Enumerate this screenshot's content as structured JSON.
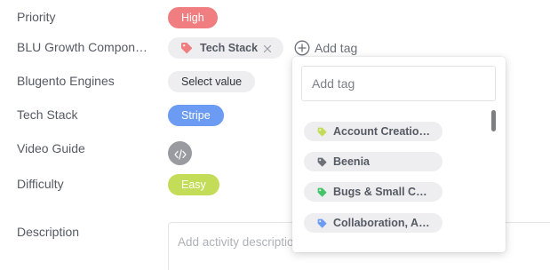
{
  "fields": {
    "priority": {
      "label": "Priority",
      "value": "High",
      "color": "#f07e80"
    },
    "blu_growth": {
      "label": "BLU Growth Compon…",
      "tag": {
        "label": "Tech Stack",
        "icon": "tag-icon",
        "color": "#f07e80"
      },
      "remove_icon": "close-icon",
      "add_tag_label": "Add tag",
      "add_tag_icon": "plus-circle-icon"
    },
    "blugento_engines": {
      "label": "Blugento Engines",
      "value": "Select value"
    },
    "tech_stack": {
      "label": "Tech Stack",
      "value": "Stripe",
      "color": "#6b9bf2"
    },
    "video_guide": {
      "label": "Video Guide",
      "icon": "code-icon"
    },
    "difficulty": {
      "label": "Difficulty",
      "value": "Easy",
      "color": "#c3dd58"
    },
    "description": {
      "label": "Description",
      "placeholder": "Add activity descriptio"
    }
  },
  "tag_dropdown": {
    "search_placeholder": "Add tag",
    "options": [
      {
        "label": "Account Creatio…",
        "icon": "tag-icon",
        "color": "#c3dd58"
      },
      {
        "label": "Beenia",
        "icon": "tag-icon",
        "color": "#6e7178"
      },
      {
        "label": "Bugs & Small C…",
        "icon": "tag-icon",
        "color": "#44c46a"
      },
      {
        "label": "Collaboration, A…",
        "icon": "tag-icon",
        "color": "#6b9bf2"
      }
    ]
  }
}
